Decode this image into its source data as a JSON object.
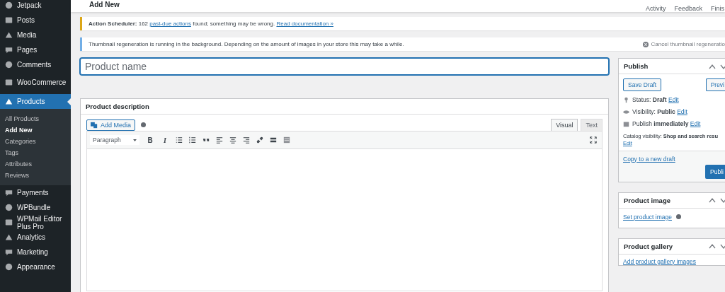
{
  "sidebar": {
    "items": [
      {
        "label": "Jetpack",
        "selected": false
      },
      {
        "label": "Posts",
        "selected": false
      },
      {
        "label": "Media",
        "selected": false
      },
      {
        "label": "Pages",
        "selected": false
      },
      {
        "label": "Comments",
        "selected": false
      },
      {
        "label": "WooCommerce",
        "selected": false
      },
      {
        "label": "Products",
        "selected": true,
        "children": [
          {
            "label": "All Products",
            "selected": false
          },
          {
            "label": "Add New",
            "selected": true
          },
          {
            "label": "Categories",
            "selected": false
          },
          {
            "label": "Tags",
            "selected": false
          },
          {
            "label": "Attributes",
            "selected": false
          },
          {
            "label": "Reviews",
            "selected": false
          }
        ]
      },
      {
        "label": "Payments",
        "selected": false
      },
      {
        "label": "WPBundle",
        "selected": false
      },
      {
        "label": "WPMail Editor Plus Pro",
        "selected": false
      },
      {
        "label": "Analytics",
        "selected": false
      },
      {
        "label": "Marketing",
        "selected": false
      },
      {
        "label": "Appearance",
        "selected": false
      }
    ]
  },
  "header": {
    "title": "Add New",
    "actions": [
      "Activity",
      "Feedback",
      "Finis"
    ]
  },
  "notices": [
    {
      "kind": "warning",
      "text": "**Action Scheduler:** 162 ",
      "link1": "past-due actions",
      "text2": " found; something may be wrong. ",
      "link2": "Read documentation »"
    },
    {
      "kind": "info",
      "text": "Thumbnail regeneration is running in the background. Depending on the amount of images in your store this may take a while.",
      "action": "Cancel thumbnail regeneratio"
    }
  ],
  "product_name": {
    "placeholder": "Product name"
  },
  "description": {
    "title": "Product description",
    "add_media": "Add Media",
    "tabs": [
      {
        "label": "Visual",
        "selected": true
      },
      {
        "label": "Text",
        "selected": false
      }
    ],
    "format": "Paragraph",
    "format_buttons": [
      "B",
      "I"
    ]
  },
  "publish": {
    "title": "Publish",
    "save_draft": "Save Draft",
    "preview": "Previ",
    "rows": [
      {
        "kind": "status",
        "label": "Status: ",
        "value": "Draft",
        "edit": "Edit"
      },
      {
        "kind": "visibility",
        "label": "Visibility: ",
        "value": "Public",
        "edit": "Edit"
      },
      {
        "kind": "schedule",
        "label": "Publish ",
        "value": "immediately",
        "edit": "Edit"
      }
    ],
    "catalog_label": "Catalog visibility: ",
    "catalog_value": "Shop and search resu",
    "catalog_edit": "Edit",
    "copy_link": "Copy to a new draft",
    "publish_button": "Publi"
  },
  "product_image": {
    "title": "Product image",
    "link": "Set product image"
  },
  "product_gallery": {
    "title": "Product gallery",
    "link": "Add product gallery images"
  }
}
